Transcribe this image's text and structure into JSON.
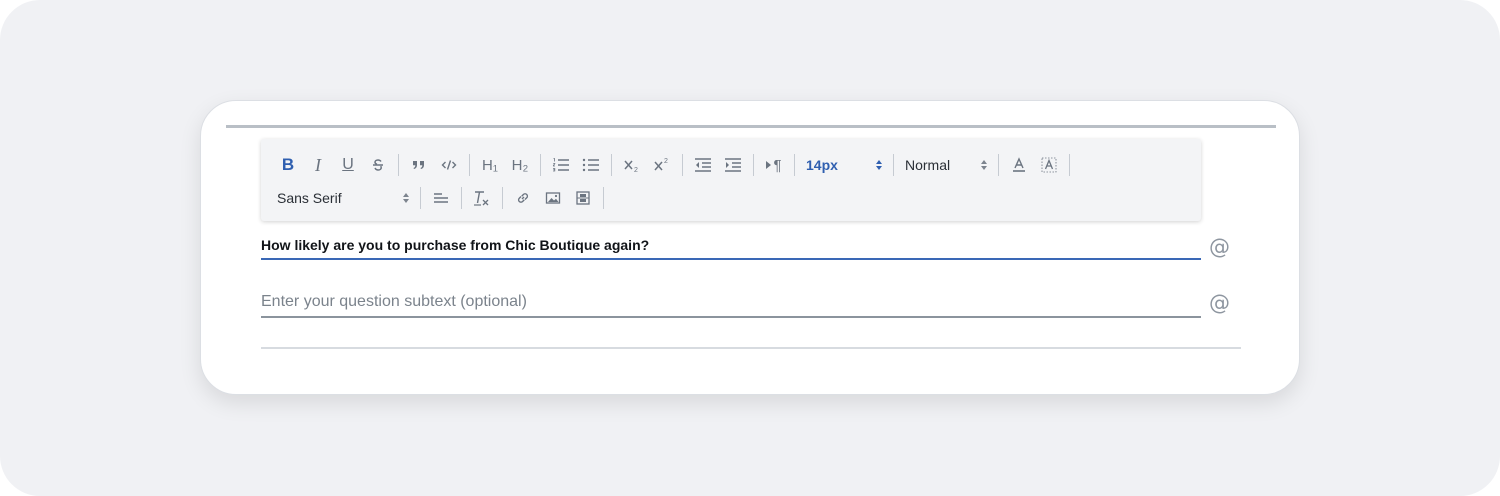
{
  "toolbar": {
    "font_size": "14px",
    "header_select": "Normal",
    "font_family": "Sans Serif",
    "bold": "B",
    "italic": "I",
    "underline": "U",
    "h1": "H₁",
    "h2": "H₂",
    "pilcrow": "¶"
  },
  "question": {
    "title": "How likely are you to purchase  from Chic Boutique again?",
    "subtext_placeholder": "Enter your question subtext (optional)",
    "mention_symbol": "@"
  },
  "colors": {
    "accent": "#2f5fb0",
    "icon": "#6b7480",
    "background": "#f0f1f4"
  }
}
